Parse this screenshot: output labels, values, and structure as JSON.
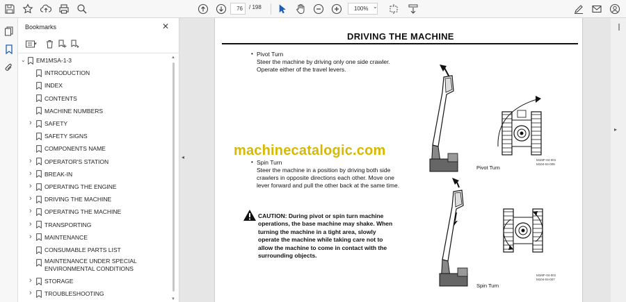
{
  "toolbar": {
    "page_current": "76",
    "page_total": "/ 198",
    "zoom": "100%"
  },
  "bookmarks_panel": {
    "title": "Bookmarks",
    "items": [
      {
        "label": "EM1MSA-1-3",
        "expandable": true,
        "expanded": true
      },
      {
        "label": "INTRODUCTION",
        "expandable": false
      },
      {
        "label": "INDEX",
        "expandable": false
      },
      {
        "label": "CONTENTS",
        "expandable": false
      },
      {
        "label": "MACHINE NUMBERS",
        "expandable": false
      },
      {
        "label": "SAFETY",
        "expandable": true
      },
      {
        "label": "SAFETY SIGNS",
        "expandable": false
      },
      {
        "label": "COMPONENTS NAME",
        "expandable": false
      },
      {
        "label": "OPERATOR'S STATION",
        "expandable": true
      },
      {
        "label": "BREAK-IN",
        "expandable": true
      },
      {
        "label": "OPERATING THE ENGINE",
        "expandable": true
      },
      {
        "label": "DRIVING THE MACHINE",
        "expandable": true
      },
      {
        "label": "OPERATING THE MACHINE",
        "expandable": true
      },
      {
        "label": "TRANSPORTING",
        "expandable": true
      },
      {
        "label": "MAINTENANCE",
        "expandable": true
      },
      {
        "label": "CONSUMABLE PARTS LIST",
        "expandable": false
      },
      {
        "label": "MAINTENANCE UNDER SPECIAL ENVIRONMENTAL CONDITIONS",
        "expandable": false
      },
      {
        "label": "STORAGE",
        "expandable": true
      },
      {
        "label": "TROUBLESHOOTING",
        "expandable": true
      }
    ]
  },
  "document": {
    "title": "DRIVING THE MACHINE",
    "bullet": "•",
    "pivot_heading": "Pivot Turn",
    "pivot_line1": "Steer the machine by driving only one side crawler.",
    "pivot_line2": "Operate either of the travel levers.",
    "watermark": "machinecatalogic.com",
    "spin_heading": "Spin Turn",
    "spin_line1": "Steer the machine in a position by driving both side",
    "spin_line2": "crawlers in opposite directions each other. Move one",
    "spin_line3": "lever forward and pull the other back at the same time.",
    "caution_lines": [
      "CAUTION:  During pivot or spin turn machine",
      "operations, the base machine may shake. When",
      "turning the machine in a tight area, slowly",
      "operate the machine while taking care not to",
      "allow the machine to come in contact with the",
      "surrounding objects."
    ],
    "fig1_label": "Pivot Turn",
    "fig1_code1": "M1MF-04-001",
    "fig1_code2": "M104-04-005",
    "fig2_label": "Spin Turn",
    "fig2_code1": "M1MF-04-001",
    "fig2_code2": "M104-04-007"
  },
  "colors": {
    "watermark": "#d9b800",
    "bookmark_icon": "#333333",
    "active_rail_icon": "#1a5fb4"
  }
}
